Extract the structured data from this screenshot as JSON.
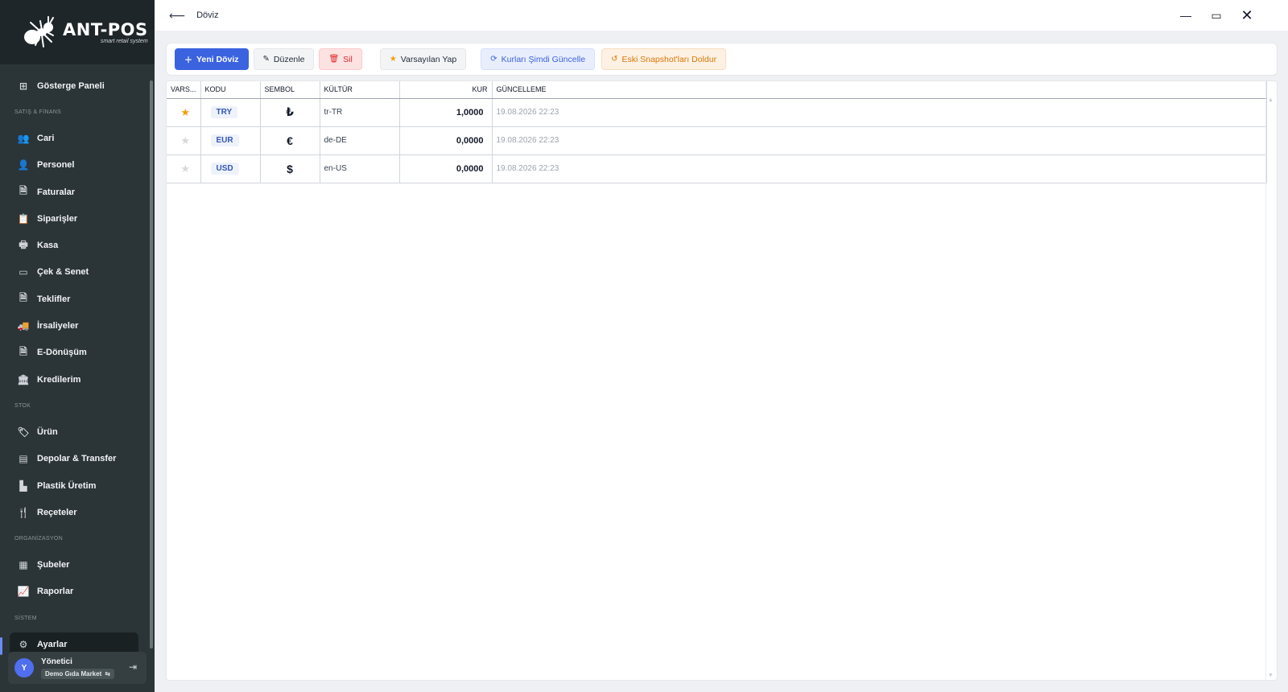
{
  "app": {
    "logo_title": "ANT-POS",
    "logo_subtitle": "smart retail system",
    "window_title": "Döviz"
  },
  "sidebar": {
    "items": [
      {
        "type": "item",
        "label": "Gösterge Paneli",
        "icon": "dashboard-icon",
        "glyph": "⊞"
      },
      {
        "type": "section",
        "label": "SATIŞ & FİNANS"
      },
      {
        "type": "item",
        "label": "Cari",
        "icon": "users-icon",
        "glyph": "👥"
      },
      {
        "type": "item",
        "label": "Personel",
        "icon": "user-gear-icon",
        "glyph": "👤"
      },
      {
        "type": "item",
        "label": "Faturalar",
        "icon": "invoice-icon",
        "glyph": "🗎"
      },
      {
        "type": "item",
        "label": "Siparişler",
        "icon": "orders-icon",
        "glyph": "📋"
      },
      {
        "type": "item",
        "label": "Kasa",
        "icon": "cash-register-icon",
        "glyph": "🖶"
      },
      {
        "type": "item",
        "label": "Çek & Senet",
        "icon": "check-icon",
        "glyph": "▭"
      },
      {
        "type": "item",
        "label": "Teklifler",
        "icon": "quote-icon",
        "glyph": "🗎"
      },
      {
        "type": "item",
        "label": "İrsaliyeler",
        "icon": "truck-icon",
        "glyph": "🚚"
      },
      {
        "type": "item",
        "label": "E-Dönüşüm",
        "icon": "e-document-icon",
        "glyph": "🗎"
      },
      {
        "type": "item",
        "label": "Kredilerim",
        "icon": "bank-icon",
        "glyph": "🏛"
      },
      {
        "type": "section",
        "label": "STOK"
      },
      {
        "type": "item",
        "label": "Ürün",
        "icon": "tag-icon",
        "glyph": "🏷"
      },
      {
        "type": "item",
        "label": "Depolar & Transfer",
        "icon": "warehouse-icon",
        "glyph": "▤"
      },
      {
        "type": "item",
        "label": "Plastik Üretim",
        "icon": "factory-icon",
        "glyph": "▙"
      },
      {
        "type": "item",
        "label": "Reçeteler",
        "icon": "utensils-icon",
        "glyph": "🍴"
      },
      {
        "type": "section",
        "label": "ORGANİZASYON"
      },
      {
        "type": "item",
        "label": "Şubeler",
        "icon": "building-icon",
        "glyph": "▦"
      },
      {
        "type": "item",
        "label": "Raporlar",
        "icon": "chart-line-icon",
        "glyph": "📈"
      },
      {
        "type": "section",
        "label": "SİSTEM"
      },
      {
        "type": "item",
        "label": "Ayarlar",
        "icon": "settings-icon",
        "glyph": "⚙",
        "active": true
      }
    ]
  },
  "user": {
    "initial": "Y",
    "name": "Yönetici",
    "company": "Demo Gıda Market"
  },
  "toolbar": {
    "new_label": "Yeni Döviz",
    "edit_label": "Düzenle",
    "delete_label": "Sil",
    "default_label": "Varsayılan Yap",
    "update_label": "Kurları Şimdi Güncelle",
    "snapshot_label": "Eski Snapshot'ları Doldur"
  },
  "grid": {
    "columns": [
      "VARS...",
      "KODU",
      "SEMBOL",
      "KÜLTÜR",
      "KUR",
      "GÜNCELLEME"
    ],
    "rows": [
      {
        "default": true,
        "code": "TRY",
        "symbol": "₺",
        "culture": "tr-TR",
        "rate": "1,0000",
        "updated": "19.08.2026 22:23"
      },
      {
        "default": false,
        "code": "EUR",
        "symbol": "€",
        "culture": "de-DE",
        "rate": "0,0000",
        "updated": "19.08.2026 22:23"
      },
      {
        "default": false,
        "code": "USD",
        "symbol": "$",
        "culture": "en-US",
        "rate": "0,0000",
        "updated": "19.08.2026 22:23"
      }
    ]
  }
}
